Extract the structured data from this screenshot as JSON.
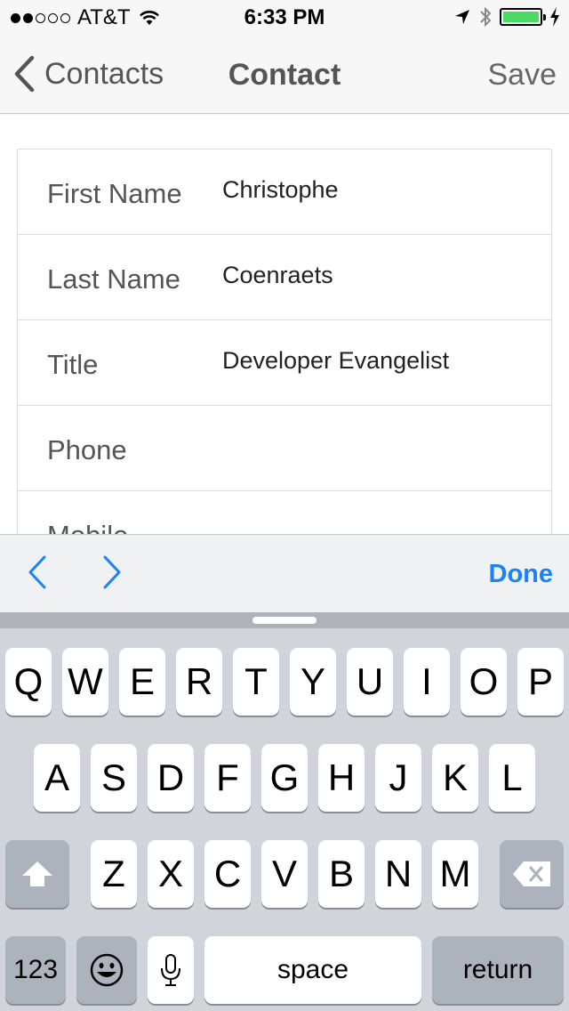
{
  "status_bar": {
    "carrier": "AT&T",
    "time": "6:33 PM",
    "signal_strength": 2,
    "signal_max": 5,
    "battery_level": 1.0,
    "battery_color": "#4cd964"
  },
  "nav": {
    "back_label": "Contacts",
    "title": "Contact",
    "save_label": "Save"
  },
  "form": {
    "rows": [
      {
        "label": "First Name",
        "value": "Christophe"
      },
      {
        "label": "Last Name",
        "value": "Coenraets"
      },
      {
        "label": "Title",
        "value": "Developer Evangelist"
      },
      {
        "label": "Phone",
        "value": ""
      },
      {
        "label": "Mobile",
        "value": ""
      }
    ]
  },
  "accessory": {
    "done_label": "Done",
    "accent_color": "#1a82fb"
  },
  "keyboard": {
    "row1": [
      "Q",
      "W",
      "E",
      "R",
      "T",
      "Y",
      "U",
      "I",
      "O",
      "P"
    ],
    "row2": [
      "A",
      "S",
      "D",
      "F",
      "G",
      "H",
      "J",
      "K",
      "L"
    ],
    "row3": [
      "Z",
      "X",
      "C",
      "V",
      "B",
      "N",
      "M"
    ],
    "numbers_label": "123",
    "space_label": "space",
    "return_label": "return"
  }
}
